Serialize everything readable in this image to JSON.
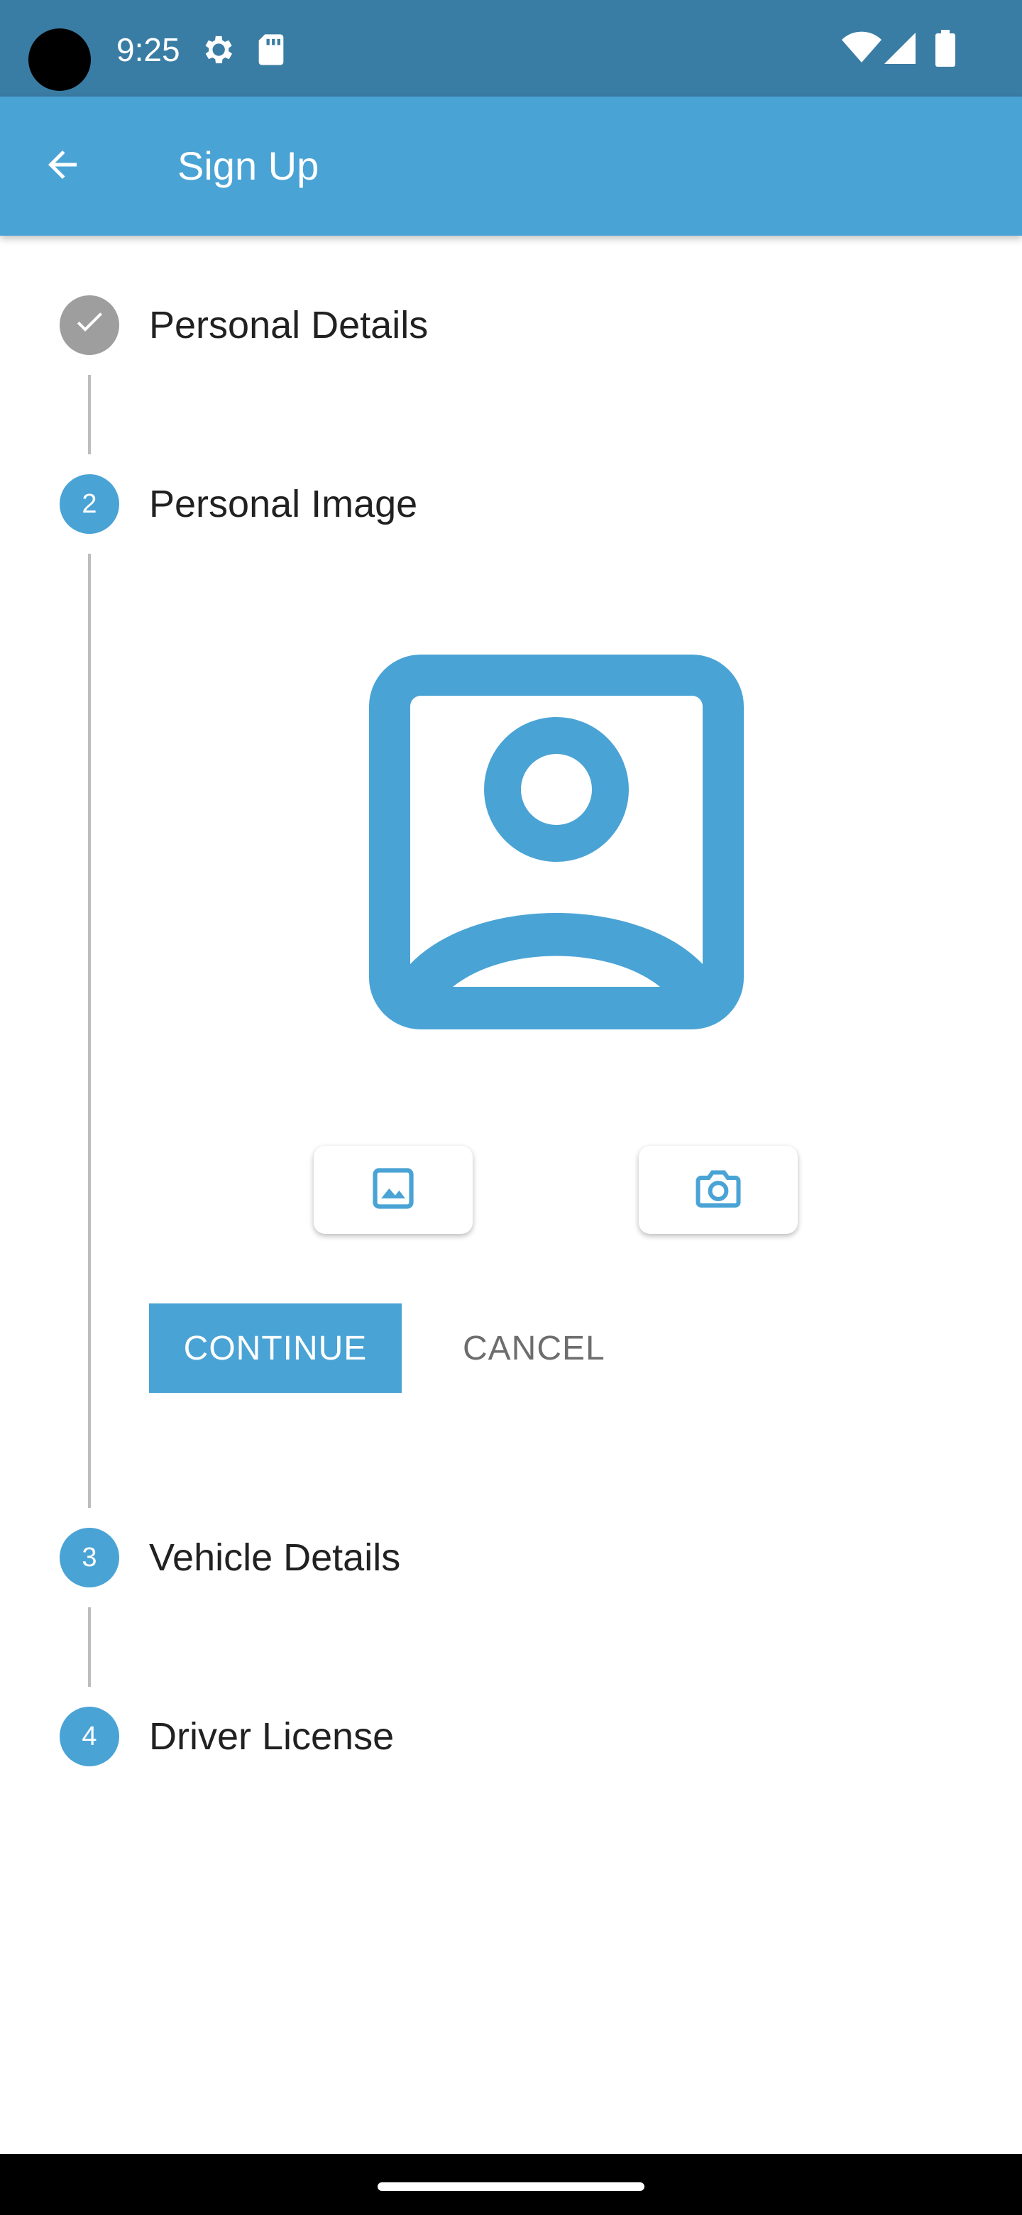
{
  "status_bar": {
    "time": "9:25",
    "icons": [
      "settings-icon",
      "sd-card-icon",
      "wifi-icon",
      "cellular-signal-icon",
      "battery-icon"
    ]
  },
  "app_bar": {
    "title": "Sign Up",
    "back_icon": "arrow-back-icon"
  },
  "stepper": {
    "steps": [
      {
        "number": "",
        "label": "Personal Details",
        "state": "completed"
      },
      {
        "number": "2",
        "label": "Personal Image",
        "state": "active"
      },
      {
        "number": "3",
        "label": "Vehicle Details",
        "state": "pending"
      },
      {
        "number": "4",
        "label": "Driver License",
        "state": "pending"
      }
    ]
  },
  "personal_image": {
    "placeholder_icon": "portrait-placeholder-icon",
    "gallery_icon": "gallery-icon",
    "camera_icon": "camera-icon",
    "continue_label": "CONTINUE",
    "cancel_label": "CANCEL"
  },
  "colors": {
    "status_bar": "#3a7da4",
    "primary": "#4aa3d5",
    "completed_step": "#9e9e9e",
    "text_primary": "#212121",
    "text_secondary": "#6d6d6d"
  }
}
